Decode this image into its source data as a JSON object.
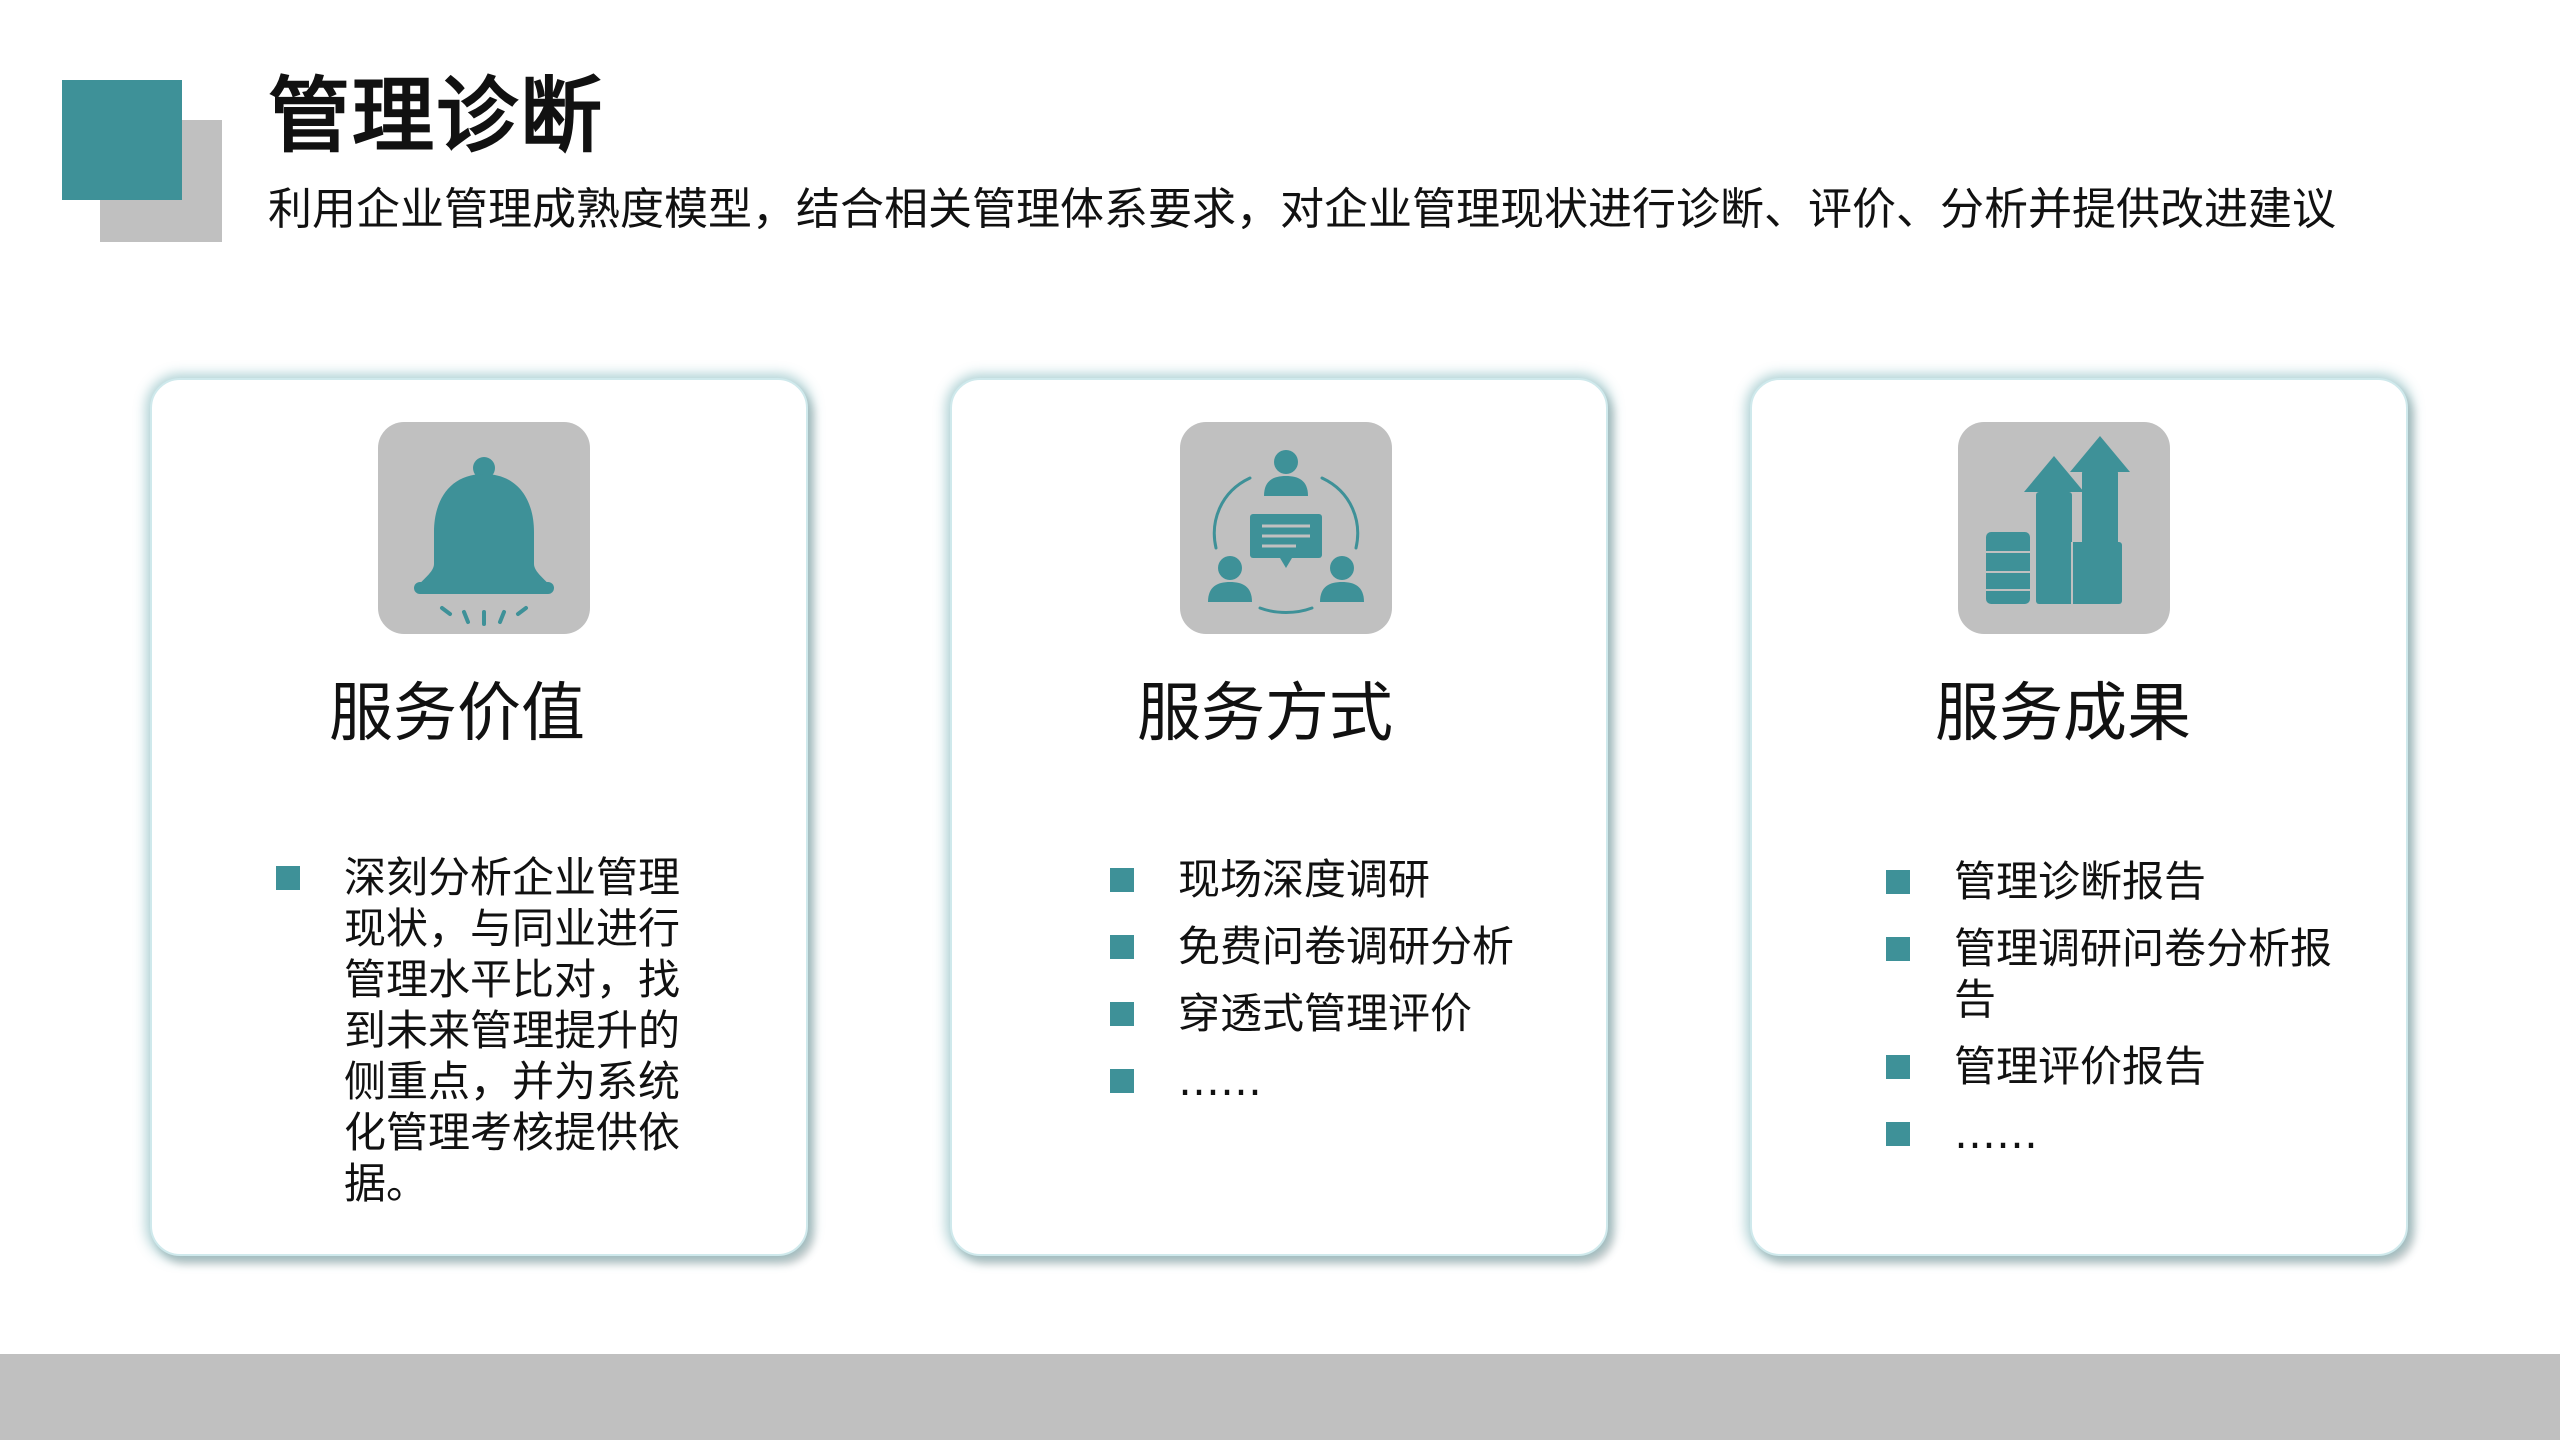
{
  "header": {
    "title": "管理诊断",
    "subtitle": "利用企业管理成熟度模型，结合相关管理体系要求，对企业管理现状进行诊断、评价、分析并提供改进建议"
  },
  "colors": {
    "accent": "#3e9198",
    "accent_secondary": "#c0c0c0",
    "icon_background": "#c0c0c0",
    "card_glow": "#3e9198"
  },
  "cards": [
    {
      "title": "服务价值",
      "icon": "bell-icon",
      "bullets": [
        "深刻分析企业管理现状，与同业进行管理水平比对，找到未来管理提升的侧重点，并为系统化管理考核提供依据。"
      ]
    },
    {
      "title": "服务方式",
      "icon": "team-discussion-icon",
      "bullets": [
        "现场深度调研",
        "免费问卷调研分析",
        "穿透式管理评价",
        "……"
      ]
    },
    {
      "title": "服务成果",
      "icon": "growth-chart-icon",
      "bullets": [
        "管理诊断报告",
        "管理调研问卷分析报告",
        "管理评价报告",
        "……"
      ]
    }
  ]
}
